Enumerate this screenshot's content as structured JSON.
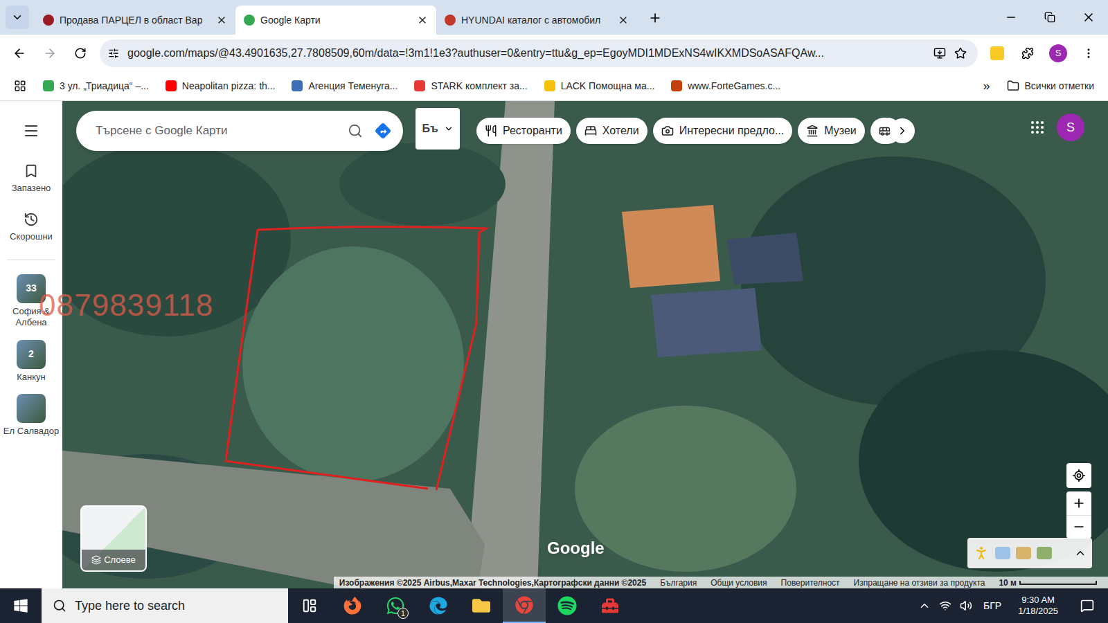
{
  "browser": {
    "tabs": [
      {
        "label": "Продава ПАРЦЕЛ в област Вар",
        "selected": false,
        "color": "#9b1b22"
      },
      {
        "label": "Google Карти",
        "selected": true,
        "color": "#34a853"
      },
      {
        "label": "HYUNDAI каталог с автомобил",
        "selected": false,
        "color": "#c0392b"
      }
    ],
    "url": "google.com/maps/@43.4901635,27.7808509,60m/data=!3m1!1e3?authuser=0&entry=ttu&g_ep=EgoyMDI1MDExNS4wIKXMDSoASAFQAw...",
    "profile": "S"
  },
  "bookmarks": {
    "items": [
      {
        "label": "3 ул. „Триадица“ –...",
        "color": "#34a853"
      },
      {
        "label": "Neapolitan pizza: th...",
        "color": "#ff0000"
      },
      {
        "label": "Агенция Теменуга...",
        "color": "#3b6fb6"
      },
      {
        "label": "STARK комплект за...",
        "color": "#e53935"
      },
      {
        "label": "LACK Помощна ма...",
        "color": "#f4c20d"
      },
      {
        "label": "www.ForteGames.c...",
        "color": "#c2410c"
      }
    ],
    "more": "»",
    "all": "Всички отметки"
  },
  "maps": {
    "nav": [
      {
        "label": "Запазено",
        "kind": "saved"
      },
      {
        "label": "Скорошни",
        "kind": "recent"
      }
    ],
    "lists": [
      {
        "label": "София & Албена",
        "count": "33"
      },
      {
        "label": "Канкун",
        "count": "2"
      },
      {
        "label": "Ел Салвадор"
      }
    ],
    "search": {
      "placeholder": "Търсене с Google Карти"
    },
    "input_tool": "Бъ",
    "chips": [
      {
        "label": "Ресторанти",
        "kind": "restaurants"
      },
      {
        "label": "Хотели",
        "kind": "hotels"
      },
      {
        "label": "Интересни предло...",
        "kind": "attractions"
      },
      {
        "label": "Музеи",
        "kind": "museums"
      },
      {
        "label": "",
        "kind": "transit"
      }
    ],
    "profile": "S",
    "layers": "Слоеве",
    "logo": "Google",
    "attribution": [
      "Изображения ©2025 Airbus,Maxar Technologies,Картографски данни ©2025",
      "България",
      "Общи условия",
      "Поверителност",
      "Изпращане на отзиви за продукта"
    ],
    "scale": "10 м"
  },
  "watermark": "0879839118",
  "taskbar": {
    "search": "Type here to search",
    "apps": [
      {
        "kind": "taskview",
        "active": false
      },
      {
        "kind": "firefox",
        "active": false
      },
      {
        "kind": "whatsapp",
        "active": false,
        "badge": "1"
      },
      {
        "kind": "edge",
        "active": false
      },
      {
        "kind": "explorer",
        "active": false
      },
      {
        "kind": "chrome",
        "active": true
      },
      {
        "kind": "spotify",
        "active": false
      },
      {
        "kind": "other",
        "active": false
      }
    ],
    "language": "БГР",
    "time": "9:30 AM",
    "date": "1/18/2025"
  }
}
